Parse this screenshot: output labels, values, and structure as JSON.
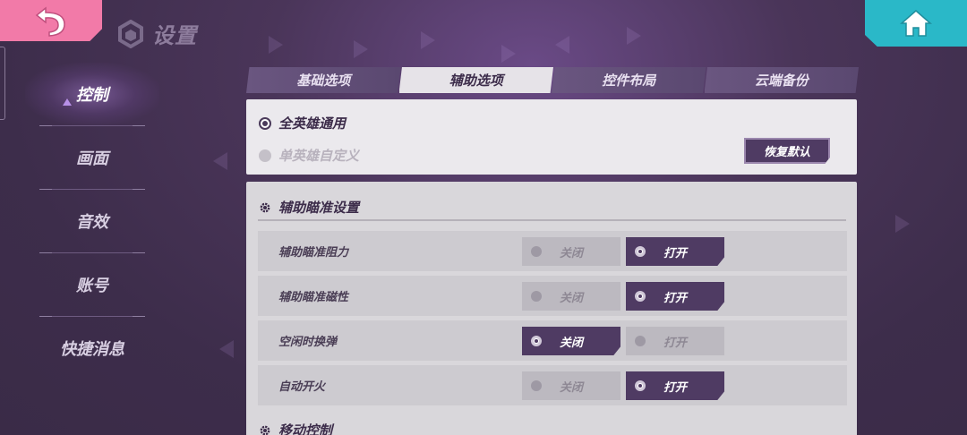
{
  "header": {
    "title": "设置"
  },
  "sidebar": {
    "items": [
      {
        "label": "控制",
        "active": true
      },
      {
        "label": "画面",
        "active": false
      },
      {
        "label": "音效",
        "active": false
      },
      {
        "label": "账号",
        "active": false
      },
      {
        "label": "快捷消息",
        "active": false
      }
    ]
  },
  "tabs": [
    {
      "label": "基础选项",
      "active": false
    },
    {
      "label": "辅助选项",
      "active": true
    },
    {
      "label": "控件布局",
      "active": false
    },
    {
      "label": "云端备份",
      "active": false
    }
  ],
  "hero_mode": {
    "option_all": "全英雄通用",
    "option_single": "单英雄自定义",
    "selected": "all",
    "reset_label": "恢复默认"
  },
  "aim_section": {
    "title": "辅助瞄准设置",
    "rows": [
      {
        "label": "辅助瞄准阻力",
        "off_label": "关闭",
        "on_label": "打开",
        "value": "on"
      },
      {
        "label": "辅助瞄准磁性",
        "off_label": "关闭",
        "on_label": "打开",
        "value": "on"
      },
      {
        "label": "空闲时换弹",
        "off_label": "关闭",
        "on_label": "打开",
        "value": "off"
      },
      {
        "label": "自动开火",
        "off_label": "关闭",
        "on_label": "打开",
        "value": "on"
      }
    ]
  },
  "move_section": {
    "title": "移动控制"
  },
  "colors": {
    "accent": "#4f3b63",
    "back": "#f27aa8",
    "home": "#2ab8c8"
  }
}
